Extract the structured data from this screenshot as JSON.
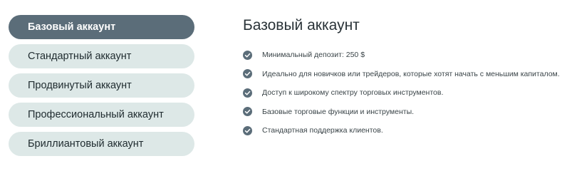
{
  "tabs": [
    {
      "label": "Базовый аккаунт",
      "active": true
    },
    {
      "label": "Стандартный аккаунт",
      "active": false
    },
    {
      "label": "Продвинутый аккаунт",
      "active": false
    },
    {
      "label": "Профессиональный аккаунт",
      "active": false
    },
    {
      "label": "Бриллиантовый аккаунт",
      "active": false
    }
  ],
  "panel": {
    "title": "Базовый аккаунт",
    "features": [
      "Минимальный депозит: 250 $",
      "Идеально для новичков или трейдеров, которые хотят начать с меньшим капиталом.",
      "Доступ к широкому спектру торговых инструментов.",
      "Базовые торговые функции и инструменты.",
      "Стандартная поддержка клиентов."
    ]
  },
  "icons": {
    "feature_icon": "check-circle-icon"
  },
  "colors": {
    "active_tab": "#5b6d79",
    "inactive_tab": "#dde8e7",
    "check": "#5b6d79"
  }
}
